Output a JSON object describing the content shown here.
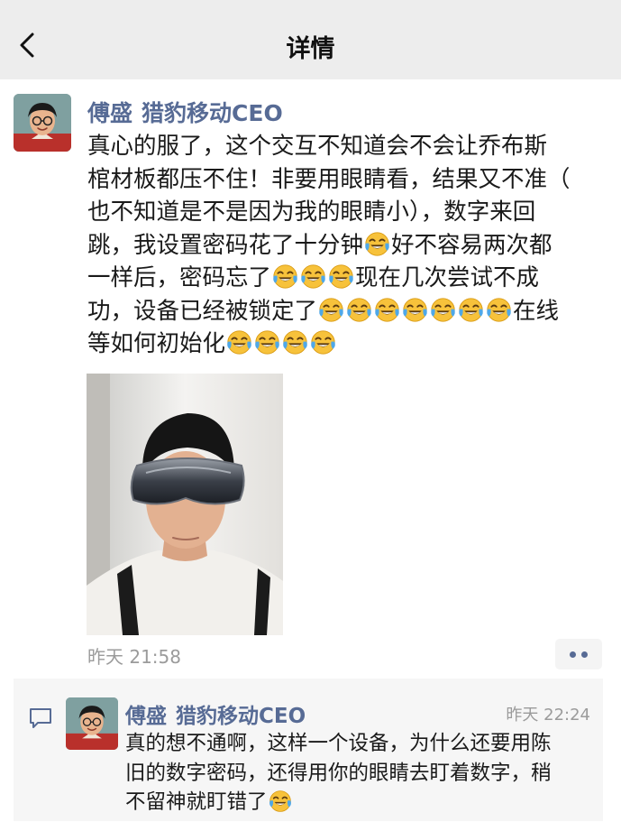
{
  "header": {
    "title": "详情",
    "back_icon": "chevron-left-icon"
  },
  "post": {
    "author_name": "傅盛",
    "author_title": "猎豹移动CEO",
    "text_lines": [
      "真心的服了，这个交互不知道会不会让乔布斯",
      "棺材板都压不住！非要用眼睛看，结果又不准（",
      "也不知道是不是因为我的眼睛小），数字来回",
      "跳，我设置密码花了十分钟",
      "好不容易两次都",
      "一样后，密码忘了",
      "现在几次尝试不成",
      "功，设备已经被锁定了",
      "在线",
      "等如何初始化"
    ],
    "emoji": "face-with-tears-of-joy-emoji",
    "time": "昨天 21:58",
    "more_icon": "two-dots-icon"
  },
  "comment": {
    "icon": "comment-icon",
    "author_name": "傅盛",
    "author_title": "猎豹移动CEO",
    "time": "昨天 22:24",
    "text_lines": [
      "真的想不通啊，这样一个设备，为什么还要用陈",
      "旧的数字密码，还得用你的眼睛去盯着数字，稍",
      "不留神就盯错了"
    ]
  },
  "colors": {
    "header_bg": "#ededed",
    "link_blue": "#576b95",
    "gray_text": "#9b9b9b",
    "comment_bg": "#f6f6f6"
  }
}
